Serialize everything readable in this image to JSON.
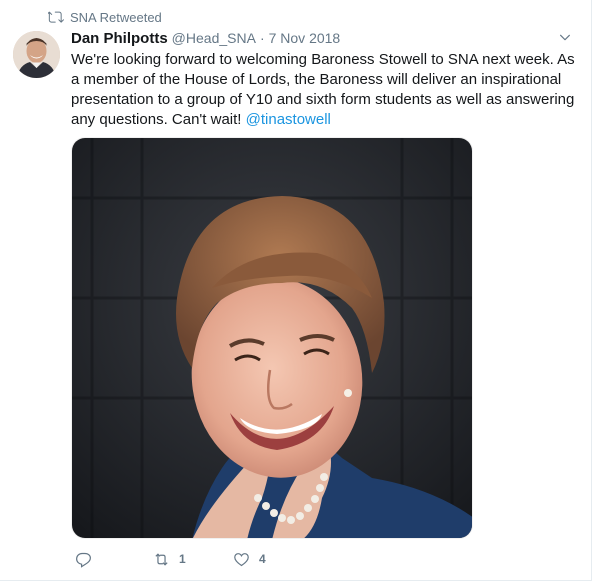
{
  "retweet_context": {
    "label": "SNA Retweeted"
  },
  "tweet": {
    "author": {
      "fullname": "Dan Philpotts",
      "handle": "@Head_SNA",
      "separator": "·",
      "timestamp": "7 Nov 2018"
    },
    "text_main": "We're looking forward to welcoming Baroness Stowell to SNA next week. As a member of the House of Lords, the Baroness will deliver an inspirational presentation to a group of Y10 and sixth form students as well as answering any questions. Can't wait! ",
    "mention": "@tinastowell",
    "actions": {
      "reply_count": "",
      "retweet_count": "1",
      "like_count": "4"
    }
  },
  "colors": {
    "link": "#1b95e0",
    "secondary_text": "#657786",
    "primary_text": "#14171a"
  },
  "icons": [
    "retweet-icon",
    "caret-down-icon",
    "reply-icon",
    "retweet-icon",
    "heart-icon"
  ]
}
